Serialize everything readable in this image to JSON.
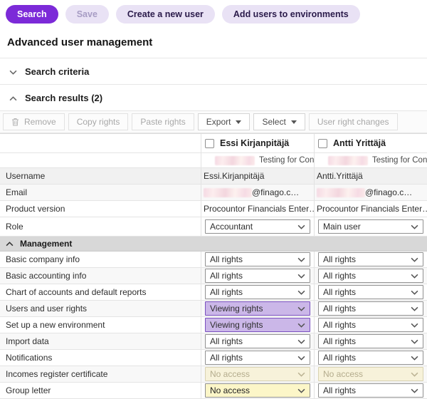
{
  "page_title": "Advanced user management",
  "header_buttons": [
    {
      "label": "Search",
      "style": "primary",
      "enabled": true
    },
    {
      "label": "Save",
      "style": "secondary",
      "enabled": false
    },
    {
      "label": "Create a new user",
      "style": "secondary",
      "enabled": true
    },
    {
      "label": "Add users to environments",
      "style": "secondary",
      "enabled": true
    }
  ],
  "search_criteria": {
    "label": "Search criteria",
    "collapsed": true
  },
  "search_results": {
    "label": "Search results (2)",
    "collapsed": false
  },
  "results_toolbar": [
    {
      "label": "Remove",
      "icon": "trash-icon",
      "enabled": false
    },
    {
      "label": "Copy rights",
      "enabled": false
    },
    {
      "label": "Paste rights",
      "enabled": false
    },
    {
      "label": "Export",
      "caret": true,
      "enabled": true
    },
    {
      "label": "Select",
      "caret": true,
      "enabled": true
    },
    {
      "label": "User right changes",
      "enabled": false
    }
  ],
  "table": {
    "users": [
      {
        "name": "Essi Kirjanpitäjä",
        "environment": "Testing for Conte…"
      },
      {
        "name": "Antti Yrittäjä",
        "environment": "Testing for Conte…"
      }
    ],
    "info_rows": [
      {
        "label": "Username",
        "type": "text",
        "name": "username-cell",
        "values": [
          "Essi.Kirjanpitäjä",
          "Antti.Yrittäjä"
        ]
      },
      {
        "label": "Email",
        "type": "redacted",
        "name": "email-cell",
        "values": [
          "@finago.c…",
          "@finago.c…"
        ]
      },
      {
        "label": "Product version",
        "type": "text",
        "name": "product-version-cell",
        "values": [
          "Procountor Financials Enter…",
          "Procountor Financials Enter…"
        ]
      },
      {
        "label": "Role",
        "type": "select",
        "name": "role-select",
        "values": [
          "Accountant",
          "Main user"
        ]
      }
    ],
    "group_label": "Management",
    "rights_rows": [
      {
        "label": "Basic company info",
        "cells": [
          {
            "value": "All rights",
            "state": "normal"
          },
          {
            "value": "All rights",
            "state": "normal"
          }
        ]
      },
      {
        "label": "Basic accounting info",
        "cells": [
          {
            "value": "All rights",
            "state": "normal"
          },
          {
            "value": "All rights",
            "state": "normal"
          }
        ]
      },
      {
        "label": "Chart of accounts and default reports",
        "cells": [
          {
            "value": "All rights",
            "state": "normal"
          },
          {
            "value": "All rights",
            "state": "normal"
          }
        ]
      },
      {
        "label": "Users and user rights",
        "cells": [
          {
            "value": "Viewing rights",
            "state": "changed"
          },
          {
            "value": "All rights",
            "state": "normal"
          }
        ]
      },
      {
        "label": "Set up a new environment",
        "cells": [
          {
            "value": "Viewing rights",
            "state": "changed"
          },
          {
            "value": "All rights",
            "state": "normal"
          }
        ]
      },
      {
        "label": "Import data",
        "cells": [
          {
            "value": "All rights",
            "state": "normal"
          },
          {
            "value": "All rights",
            "state": "normal"
          }
        ]
      },
      {
        "label": "Notifications",
        "cells": [
          {
            "value": "All rights",
            "state": "normal"
          },
          {
            "value": "All rights",
            "state": "normal"
          }
        ]
      },
      {
        "label": "Incomes register certificate",
        "cells": [
          {
            "value": "No access",
            "state": "disabled"
          },
          {
            "value": "No access",
            "state": "disabled"
          }
        ]
      },
      {
        "label": "Group letter",
        "cells": [
          {
            "value": "No access",
            "state": "changed-yellow"
          },
          {
            "value": "All rights",
            "state": "normal"
          }
        ]
      }
    ]
  },
  "colors": {
    "accent_purple": "#7c2ad8",
    "secondary_button": "#e9e2f5",
    "changed_highlight": "#cbb7e8",
    "disabled_yellow": "#f7f2da",
    "changed_yellow": "#fcf6c8",
    "group_header_bg": "#d8d8d8"
  }
}
